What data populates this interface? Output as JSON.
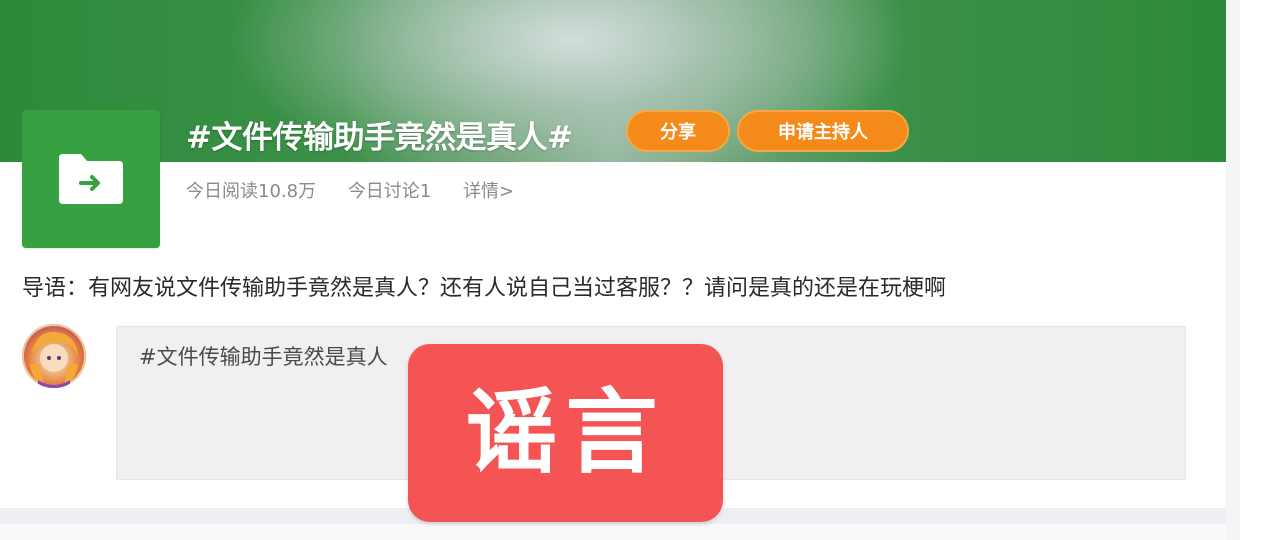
{
  "topic": {
    "title": "#文件传输助手竟然是真人#",
    "share_label": "分享",
    "apply_host_label": "申请主持人",
    "stats": {
      "reads_today": "今日阅读10.8万",
      "discussions_today": "今日讨论1",
      "details_link": "详情>"
    },
    "intro": "导语：有网友说文件传输助手竟然是真人？还有人说自己当过客服？？请问是真的还是在玩梗啊",
    "icon": "folder-arrow-icon"
  },
  "composer": {
    "prefill_text": "#文件传输助手竟然是真人"
  },
  "overlay": {
    "stamp_text": "谣言"
  },
  "colors": {
    "banner_green": "#2b8a3a",
    "folder_tile_green": "#37a041",
    "pill_orange": "#f38a1a",
    "rumor_red": "#f45454"
  }
}
